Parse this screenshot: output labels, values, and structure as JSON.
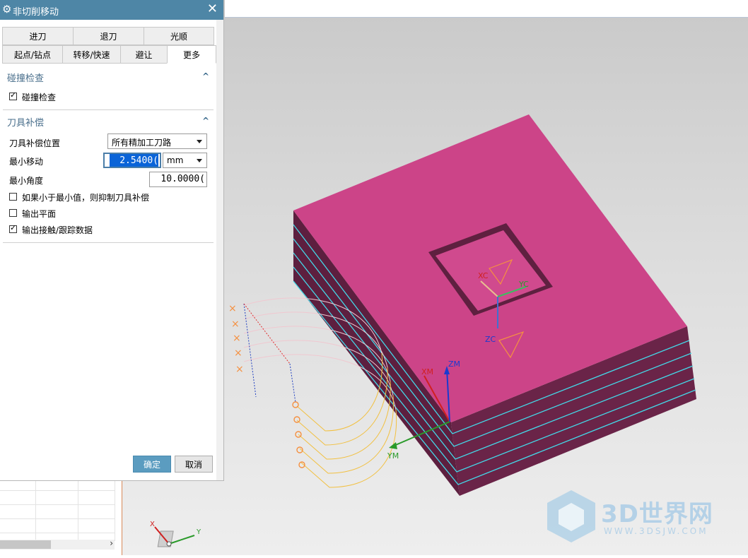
{
  "dialog": {
    "title": "非切削移动",
    "close_glyph": "✕",
    "tabs_row1": [
      "进刀",
      "退刀",
      "光顺"
    ],
    "tabs_row2": [
      "起点/钻点",
      "转移/快速",
      "避让",
      "更多"
    ],
    "active_tab": "更多",
    "sections": {
      "collision": {
        "title": "碰撞检查",
        "checkbox_label": "碰撞检查",
        "checked": true
      },
      "compensation": {
        "title": "刀具补偿",
        "position_label": "刀具补偿位置",
        "position_value": "所有精加工刀路",
        "min_move_label": "最小移动",
        "min_move_value": "2.5400(",
        "min_move_unit": "mm",
        "min_angle_label": "最小角度",
        "min_angle_value": "10.0000(",
        "suppress_label": "如果小于最小值，则抑制刀具补偿",
        "suppress_checked": false,
        "output_plane_label": "输出平面",
        "output_plane_checked": false,
        "output_contact_label": "输出接触/跟踪数据",
        "output_contact_checked": true
      }
    },
    "ok_label": "确定",
    "cancel_label": "取消"
  },
  "viewport": {
    "axis_labels": {
      "xc": "XC",
      "yc": "YC",
      "zc": "ZC",
      "xm": "XM",
      "ym": "YM",
      "zm": "ZM",
      "triad_x": "X",
      "triad_y": "Y"
    },
    "part_color": "#cc4488",
    "side_color": "#6a2448",
    "edge_color": "#44d8e8"
  },
  "watermark": {
    "text": "3D世界网",
    "sub": "WWW.3DSJW.COM"
  }
}
